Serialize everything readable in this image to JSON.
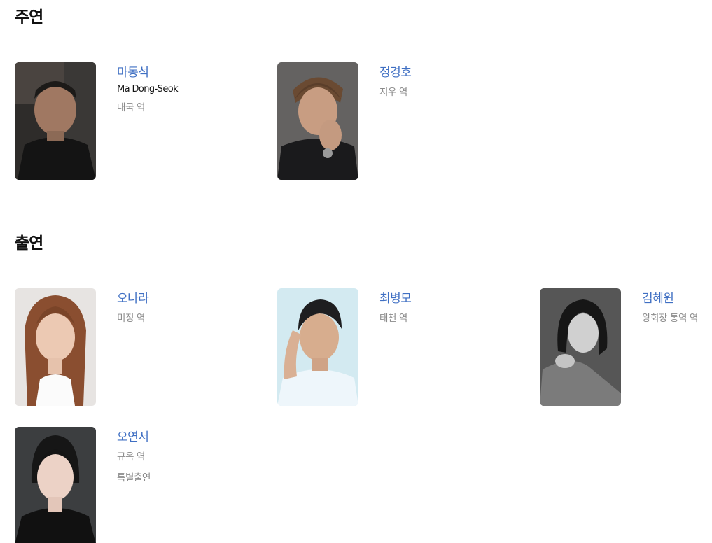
{
  "sections": [
    {
      "title": "주연",
      "cast": [
        {
          "name": "마동석",
          "name_en": "Ma Dong-Seok",
          "role": "대국 역"
        },
        {
          "name": "정경호",
          "role": "지우 역"
        }
      ]
    },
    {
      "title": "출연",
      "cast": [
        {
          "name": "오나라",
          "role": "미정 역"
        },
        {
          "name": "최병모",
          "role": "태천 역"
        },
        {
          "name": "김혜원",
          "role": "왕회장 통역 역"
        },
        {
          "name": "오연서",
          "role": "규옥 역",
          "note": "특별출연"
        }
      ]
    }
  ],
  "icons": [
    "actor-photo"
  ]
}
